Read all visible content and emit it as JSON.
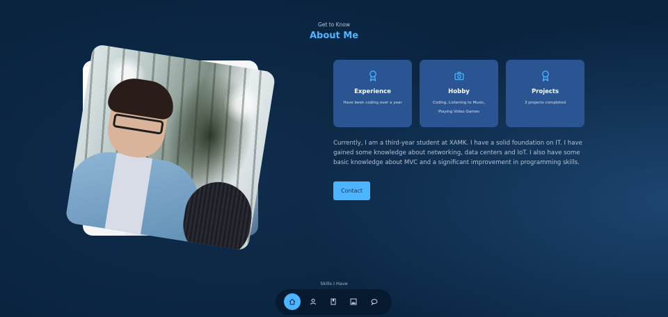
{
  "header": {
    "eyebrow": "Get to Know",
    "title": "About Me"
  },
  "photo": {
    "alt": "Portrait of a young man in a denim jacket in a snowy forest"
  },
  "cards": [
    {
      "icon": "award-icon",
      "title": "Experience",
      "text": "Have been coding over a year"
    },
    {
      "icon": "camera-icon",
      "title": "Hobby",
      "text": "Coding, Listening to Music, Playing Video Games"
    },
    {
      "icon": "award-icon",
      "title": "Projects",
      "text": "3 projects completed"
    }
  ],
  "about_text": "Currently, I am a third-year student at XAMK. I have a solid foundation on IT. I have gained some knowledge about networking, data centers and IoT. I also have some basic knowledge about MVC and a significant improvement in programming skills.",
  "contact_label": "Contact",
  "next_section_label": "Skills I Have",
  "nav": {
    "items": [
      {
        "icon": "home-icon",
        "active": true
      },
      {
        "icon": "user-icon",
        "active": false
      },
      {
        "icon": "book-icon",
        "active": false
      },
      {
        "icon": "image-icon",
        "active": false
      },
      {
        "icon": "message-icon",
        "active": false
      }
    ]
  },
  "colors": {
    "accent": "#4db5ff",
    "card_bg": "#2b5592",
    "page_bg": "#0a2440"
  }
}
